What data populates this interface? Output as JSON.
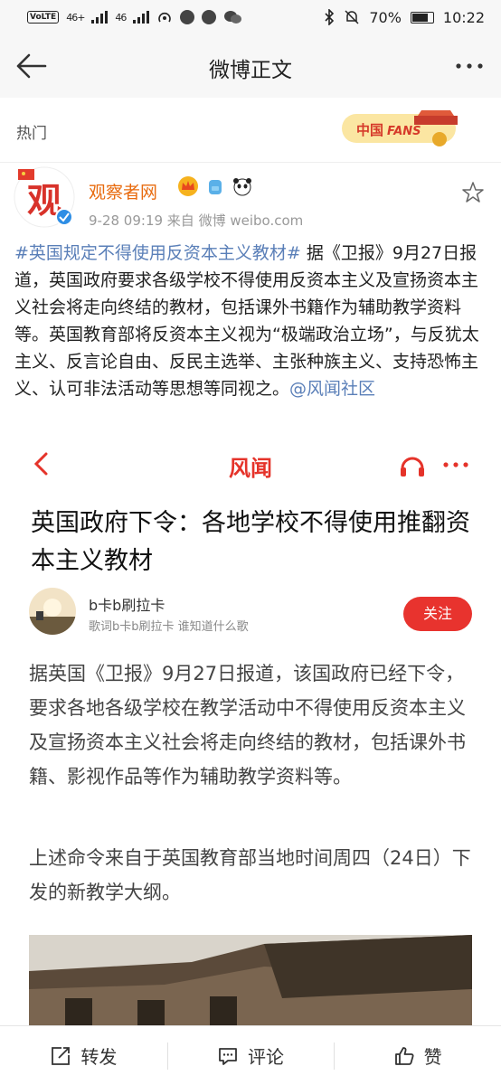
{
  "status_bar": {
    "volte": "VoLTE",
    "signal1": "46+",
    "signal2": "46",
    "battery": "70%",
    "battery_level": 0.7,
    "time": "10:22"
  },
  "nav": {
    "title": "微博正文",
    "back_icon": "back-arrow-icon",
    "more_icon": "more-dots-icon"
  },
  "hot": {
    "label": "热门",
    "badge_alt": "中国FANS"
  },
  "post": {
    "username": "观察者网",
    "meta": "9-28 09:19   来自 微博 weibo.com",
    "hashtag": "#英国规定不得使用反资本主义教材#",
    "text": " 据《卫报》9月27日报道，英国政府要求各级学校不得使用反资本主义及宣扬资本主义社会将走向终结的教材，包括课外书籍作为辅助教学资料等。英国教育部将反资本主义视为“极端政治立场”，与反犹太主义、反言论自由、反民主选举、主张种族主义、支持恐怖主义、认可非法活动等思想等同视之。",
    "mention": "@风闻社区"
  },
  "embed": {
    "brand": "风闻",
    "title": "英国政府下令：各地学校不得使用推翻资本主义教材",
    "author": "b卡b刷拉卡",
    "author_sub": "歌词b卡b刷拉卡 谁知道什么歌",
    "follow": "关注",
    "para1": "据英国《卫报》9月27日报道，该国政府已经下令，要求各地各级学校在教学活动中不得使用反资本主义及宣扬资本主义社会将走向终结的教材，包括课外书籍、影视作品等作为辅助教学资料等。",
    "para2": "上述命令来自于英国教育部当地时间周四（24日）下发的新教学大纲。"
  },
  "actions": {
    "repost": "转发",
    "comment": "评论",
    "like": "赞"
  },
  "colors": {
    "username": "#e86b0f",
    "link": "#5a7fb8",
    "brand_red": "#e5332a",
    "follow_bg": "#e8332e"
  }
}
